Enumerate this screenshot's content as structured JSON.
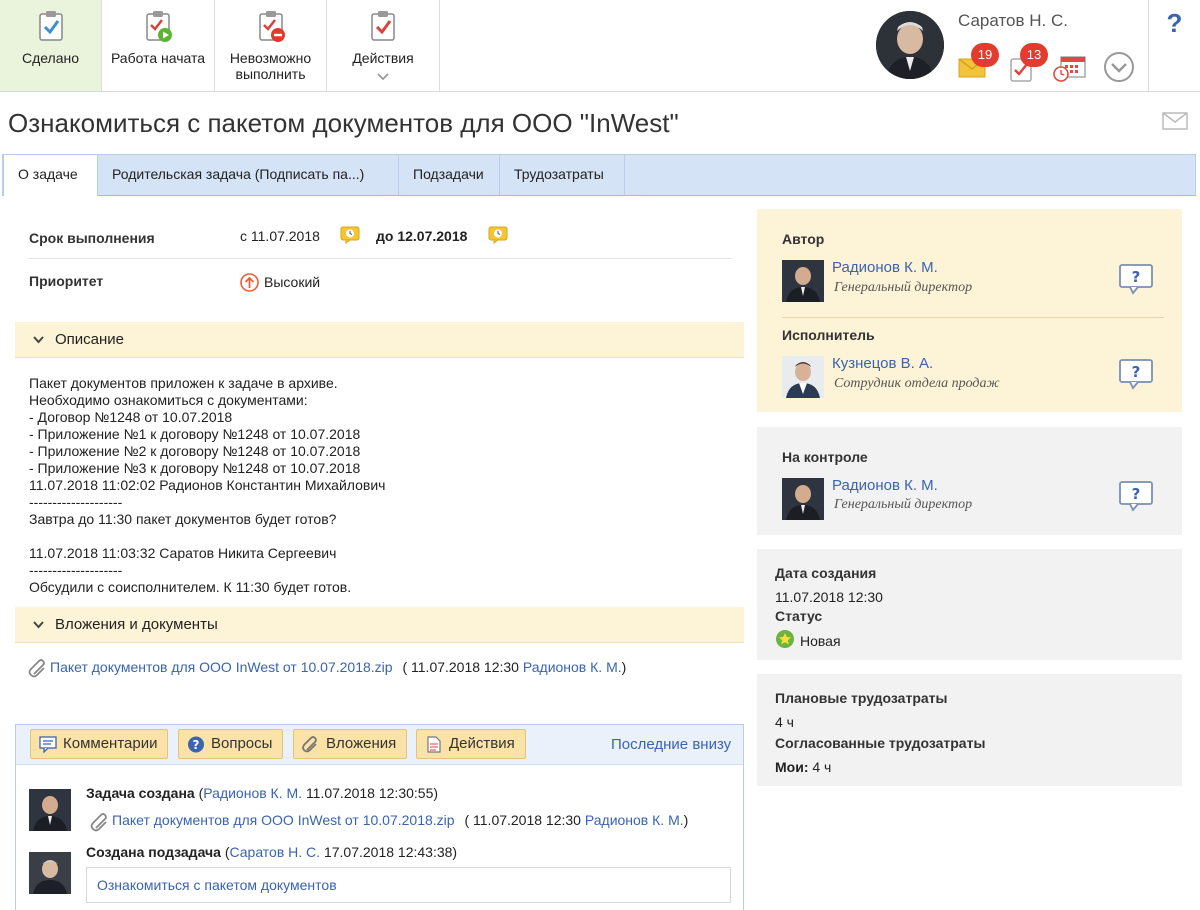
{
  "toolbar": {
    "done_label": "Сделано",
    "started_label": "Работа начата",
    "impossible_label_1": "Невозможно",
    "impossible_label_2": "выполнить",
    "actions_label": "Действия"
  },
  "user": {
    "name": "Саратов Н. С.",
    "mail_count": "19",
    "tasks_count": "13",
    "help": "?"
  },
  "page": {
    "title": "Ознакомиться с пакетом документов для ООО \"InWest\""
  },
  "tabs": [
    {
      "label": "О задаче"
    },
    {
      "label": "Родительская задача (Подписать па...)"
    },
    {
      "label": "Подзадачи"
    },
    {
      "label": "Трудозатраты"
    }
  ],
  "task": {
    "deadline_label": "Срок выполнения",
    "deadline_from": "с 11.07.2018",
    "deadline_to": "до 12.07.2018",
    "priority_label": "Приоритет",
    "priority_value": "Высокий"
  },
  "description": {
    "header": "Описание",
    "lines": [
      "Пакет документов приложен к задаче в архиве.",
      "Необходимо ознакомиться с документами:",
      "- Договор №1248 от 10.07.2018",
      "- Приложение №1 к договору №1248 от 10.07.2018",
      "- Приложение №2 к договору №1248 от 10.07.2018",
      "- Приложение №3 к договору №1248 от 10.07.2018",
      "11.07.2018 11:02:02 Радионов Константин Михайлович",
      "--------------------",
      "Завтра до 11:30 пакет документов будет готов?",
      "",
      "11.07.2018 11:03:32 Саратов Никита Сергеевич",
      "--------------------",
      "Обсудили с соисполнителем. К 11:30 будет готов."
    ]
  },
  "attachments": {
    "header": "Вложения и документы",
    "file_name": "Пакет документов для ООО InWest от 10.07.2018.zip",
    "file_open": "(",
    "file_date": "11.07.2018 12:30",
    "file_author": "Радионов К. М.",
    "file_close": ")"
  },
  "comments": {
    "btn_comments": "Комментарии",
    "btn_questions": "Вопросы",
    "btn_attachments": "Вложения",
    "btn_actions": "Действия",
    "order": "Последние внизу",
    "events": [
      {
        "title": "Задача создана",
        "open": "(",
        "author": "Радионов К. М.",
        "time": "11.07.2018 12:30:55)",
        "file": "Пакет документов для ООО InWest от 10.07.2018.zip",
        "file_open": "(",
        "file_date": "11.07.2018 12:30",
        "file_author": "Радионов К. М.",
        "file_close": ")"
      },
      {
        "title": "Создана подзадача",
        "open": "(",
        "author": "Саратов Н. С.",
        "time": "17.07.2018 12:43:38)",
        "subtask": "Ознакомиться с пакетом документов"
      }
    ]
  },
  "participants": {
    "author_label": "Автор",
    "author_name": "Радионов К. М.",
    "author_role": "Генеральный директор",
    "executor_label": "Исполнитель",
    "executor_name": "Кузнецов В. А.",
    "executor_role": "Сотрудник отдела продаж",
    "control_label": "На контроле",
    "control_name": "Радионов К. М.",
    "control_role": "Генеральный директор"
  },
  "info": {
    "created_label": "Дата создания",
    "created_value": "11.07.2018 12:30",
    "status_label": "Статус",
    "status_value": "Новая",
    "planned_label": "Плановые трудозатраты",
    "planned_value": "4 ч",
    "agreed_label": "Согласованные трудозатраты",
    "mine_label": "Мои:",
    "mine_value": "4 ч"
  },
  "colors": {
    "link": "#3a64b0",
    "tabs_bg": "#d5e3f6",
    "section_bg": "#fdf3d6",
    "panel_yellow": "#fdf3d6",
    "panel_gray": "#f2f2f2",
    "badge": "#e43b2f",
    "done_bg": "#eaf4dc"
  }
}
